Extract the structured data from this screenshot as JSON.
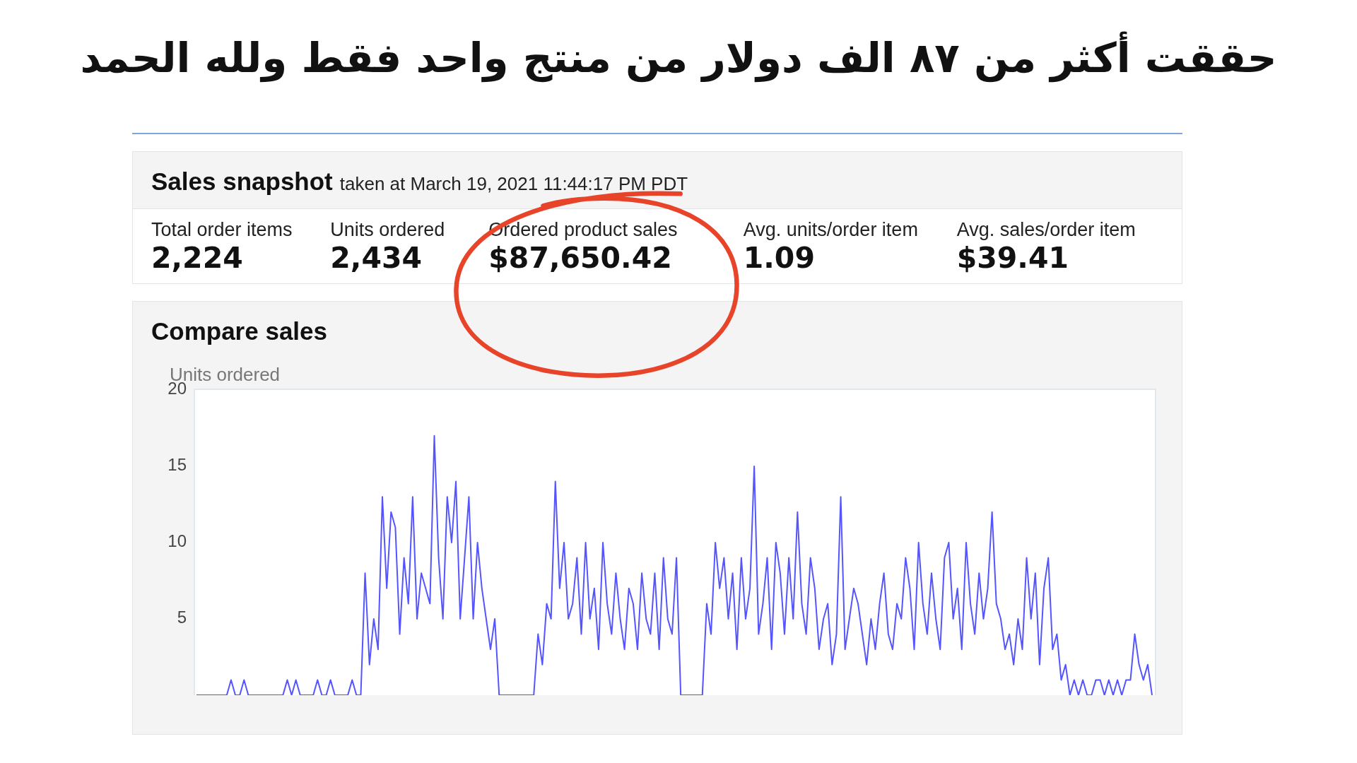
{
  "headline": "حققت أكثر من ٨٧ الف دولار من منتج واحد فقط ولله الحمد",
  "snapshot": {
    "title": "Sales snapshot",
    "taken_at": "taken at March 19, 2021 11:44:17 PM PDT",
    "metrics": [
      {
        "label": "Total order items",
        "value": "2,224"
      },
      {
        "label": "Units ordered",
        "value": "2,434"
      },
      {
        "label": "Ordered product sales",
        "value": "$87,650.42",
        "circled": true
      },
      {
        "label": "Avg. units/order item",
        "value": "1.09"
      },
      {
        "label": "Avg. sales/order item",
        "value": "$39.41"
      }
    ]
  },
  "compare": {
    "title": "Compare sales",
    "chart_data": {
      "type": "line",
      "ylabel": "Units ordered",
      "ylim": [
        0,
        20
      ],
      "yticks": [
        5,
        10,
        15,
        20
      ],
      "series": [
        {
          "color": "#5555ff",
          "values": [
            0,
            0,
            0,
            0,
            0,
            0,
            0,
            0,
            1,
            0,
            0,
            1,
            0,
            0,
            0,
            0,
            0,
            0,
            0,
            0,
            0,
            1,
            0,
            1,
            0,
            0,
            0,
            0,
            1,
            0,
            0,
            1,
            0,
            0,
            0,
            0,
            1,
            0,
            0,
            8,
            2,
            5,
            3,
            13,
            7,
            12,
            11,
            4,
            9,
            6,
            13,
            5,
            8,
            7,
            6,
            17,
            9,
            5,
            13,
            10,
            14,
            5,
            9,
            13,
            5,
            10,
            7,
            5,
            3,
            5,
            0,
            0,
            0,
            0,
            0,
            0,
            0,
            0,
            0,
            4,
            2,
            6,
            5,
            14,
            7,
            10,
            5,
            6,
            9,
            4,
            10,
            5,
            7,
            3,
            10,
            6,
            4,
            8,
            5,
            3,
            7,
            6,
            3,
            8,
            5,
            4,
            8,
            3,
            9,
            5,
            4,
            9,
            0,
            0,
            0,
            0,
            0,
            0,
            6,
            4,
            10,
            7,
            9,
            5,
            8,
            3,
            9,
            5,
            7,
            15,
            4,
            6,
            9,
            3,
            10,
            8,
            4,
            9,
            5,
            12,
            6,
            4,
            9,
            7,
            3,
            5,
            6,
            2,
            4,
            13,
            3,
            5,
            7,
            6,
            4,
            2,
            5,
            3,
            6,
            8,
            4,
            3,
            6,
            5,
            9,
            7,
            3,
            10,
            6,
            4,
            8,
            5,
            3,
            9,
            10,
            5,
            7,
            3,
            10,
            6,
            4,
            8,
            5,
            7,
            12,
            6,
            5,
            3,
            4,
            2,
            5,
            3,
            9,
            5,
            8,
            2,
            7,
            9,
            3,
            4,
            1,
            2,
            0,
            1,
            0,
            1,
            0,
            0,
            1,
            1,
            0,
            1,
            0,
            1,
            0,
            1,
            1,
            4,
            2,
            1,
            2,
            0
          ]
        }
      ]
    }
  }
}
